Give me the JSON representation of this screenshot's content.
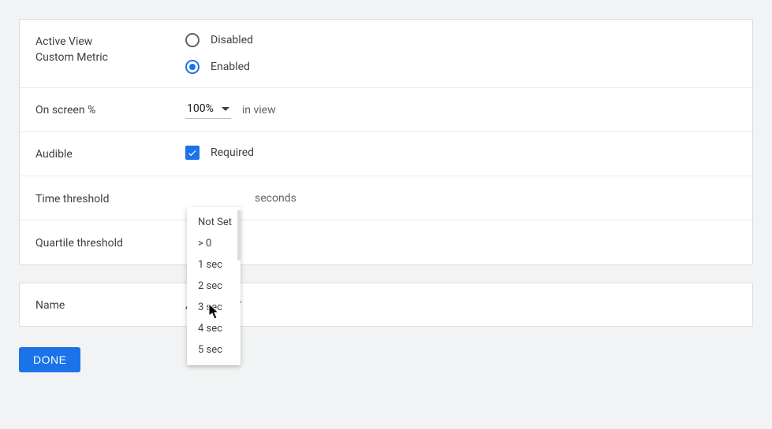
{
  "settings": {
    "active_view_label1": "Active View",
    "active_view_label2": "Custom Metric",
    "radio_disabled": "Disabled",
    "radio_enabled": "Enabled",
    "on_screen_label": "On screen %",
    "on_screen_value": "100%",
    "on_screen_suffix": "in view",
    "audible_label": "Audible",
    "audible_required": "Required",
    "time_threshold_label": "Time threshold",
    "time_threshold_suffix": "seconds",
    "quartile_threshold_label": "Quartile threshold"
  },
  "dropdown": {
    "items": [
      "Not Set",
      "> 0",
      "1 sec",
      "2 sec",
      "3 sec",
      "4 sec",
      "5 sec"
    ]
  },
  "name_row": {
    "label": "Name",
    "value_suffix": ", Audible"
  },
  "done_label": "DONE"
}
